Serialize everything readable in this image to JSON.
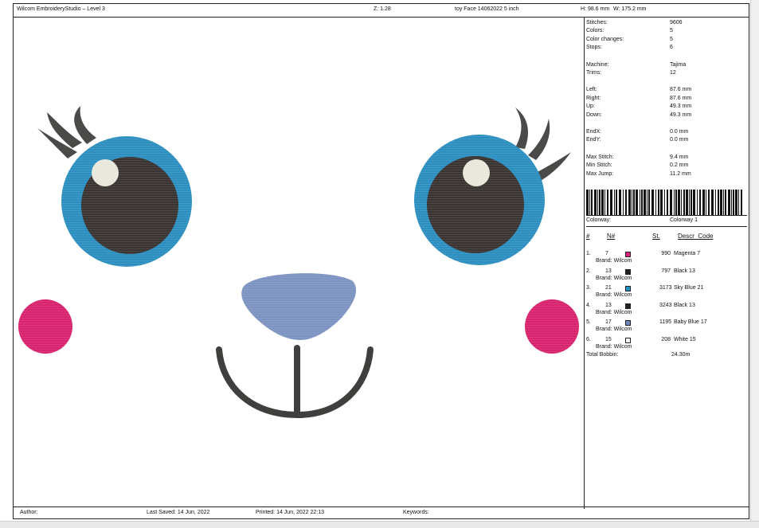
{
  "header": {
    "app_title": "Wilcom EmbroideryStudio – Level 3",
    "zoom": "Z: 1.28",
    "design_name": "toy Face 14062022 5 inch",
    "height": "H: 98.6 mm",
    "width": "W: 175.2 mm"
  },
  "stats": [
    {
      "label": "Stitches:",
      "value": "9606"
    },
    {
      "label": "Colors:",
      "value": "5"
    },
    {
      "label": "Color changes:",
      "value": "5"
    },
    {
      "label": "Stops:",
      "value": "6"
    },
    {
      "label": "Machine:",
      "value": "Tajima"
    },
    {
      "label": "Trims:",
      "value": "12"
    },
    {
      "label": "Left:",
      "value": "87.6 mm"
    },
    {
      "label": "Right:",
      "value": "87.6 mm"
    },
    {
      "label": "Up:",
      "value": "49.3 mm"
    },
    {
      "label": "Down:",
      "value": "49.3 mm"
    },
    {
      "label": "EndX:",
      "value": "0.0 mm"
    },
    {
      "label": "EndY:",
      "value": "0.0 mm"
    },
    {
      "label": "Max Stitch:",
      "value": "9.4 mm"
    },
    {
      "label": "Min Stitch:",
      "value": "0.2 mm"
    },
    {
      "label": "Max Jump:",
      "value": "11.2 mm"
    }
  ],
  "colorway": {
    "label": "Colorway:",
    "value": "Colorway 1"
  },
  "color_table": {
    "headers": {
      "num": "#",
      "needle": "N#",
      "stitches": "St.",
      "descr": "Descr_Code"
    },
    "rows": [
      {
        "num": "1.",
        "needle": "7",
        "color": "#e0237a",
        "stitches": "990",
        "descr": "Magenta 7",
        "brand": "Brand: Wilcom"
      },
      {
        "num": "2.",
        "needle": "13",
        "color": "#222222",
        "stitches": "797",
        "descr": "Black 13",
        "brand": "Brand: Wilcom"
      },
      {
        "num": "3.",
        "needle": "21",
        "color": "#1e8fc0",
        "stitches": "3173",
        "descr": "Sky Blue 21",
        "brand": "Brand: Wilcom"
      },
      {
        "num": "4.",
        "needle": "13",
        "color": "#222222",
        "stitches": "3243",
        "descr": "Black 13",
        "brand": "Brand: Wilcom"
      },
      {
        "num": "5.",
        "needle": "17",
        "color": "#6f87b4",
        "stitches": "1195",
        "descr": "Baby Blue 17",
        "brand": "Brand: Wilcom"
      },
      {
        "num": "6.",
        "needle": "15",
        "color": "#ffffff",
        "stitches": "208",
        "descr": "White 15",
        "brand": "Brand: Wilcom"
      }
    ],
    "total_bobbin_label": "Total Bobbin:",
    "total_bobbin_value": "24.30m"
  },
  "footer": {
    "author": "Author:",
    "last_saved": "Last Saved: 14 Jun, 2022",
    "printed": "Printed: 14 Jun, 2022 22:13",
    "keywords": "Keywords:"
  }
}
